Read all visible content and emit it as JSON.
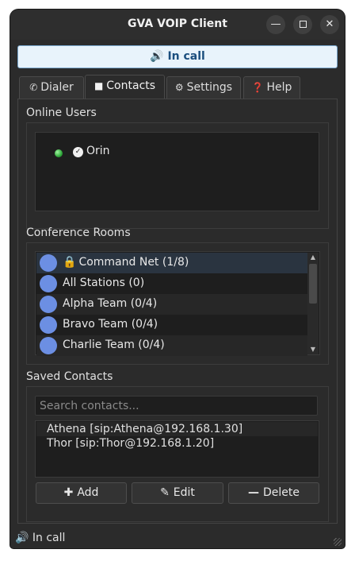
{
  "window": {
    "title": "GVA VOIP Client"
  },
  "banner": {
    "text": "In call",
    "icon": "speaker-icon"
  },
  "tabs": [
    {
      "label": "Dialer",
      "icon": "phone-icon"
    },
    {
      "label": "Contacts",
      "icon": "contact-card-icon",
      "active": true
    },
    {
      "label": "Settings",
      "icon": "gear-icon"
    },
    {
      "label": "Help",
      "icon": "question-icon"
    }
  ],
  "online_users": {
    "label": "Online Users",
    "users": [
      {
        "name": "Orin",
        "status": "online"
      }
    ]
  },
  "conference_rooms": {
    "label": "Conference Rooms",
    "rooms": [
      {
        "name": "Command Net (1/8)",
        "locked": true,
        "selected": true
      },
      {
        "name": "All Stations (0)"
      },
      {
        "name": "Alpha Team (0/4)"
      },
      {
        "name": "Bravo Team (0/4)"
      },
      {
        "name": "Charlie Team (0/4)"
      }
    ]
  },
  "saved_contacts": {
    "label": "Saved Contacts",
    "search_placeholder": "Search contacts...",
    "contacts": [
      {
        "text": "Athena  [sip:Athena@192.168.1.30]"
      },
      {
        "text": "Thor  [sip:Thor@192.168.1.20]"
      }
    ],
    "buttons": {
      "add": "Add",
      "edit": "Edit",
      "delete": "Delete"
    }
  },
  "statusbar": {
    "text": "In call"
  },
  "colors": {
    "online": "#2fa83a",
    "room_avatar": "#6c8fe3",
    "banner_bg": "#e8f3fb",
    "banner_text": "#1b4e7e"
  }
}
